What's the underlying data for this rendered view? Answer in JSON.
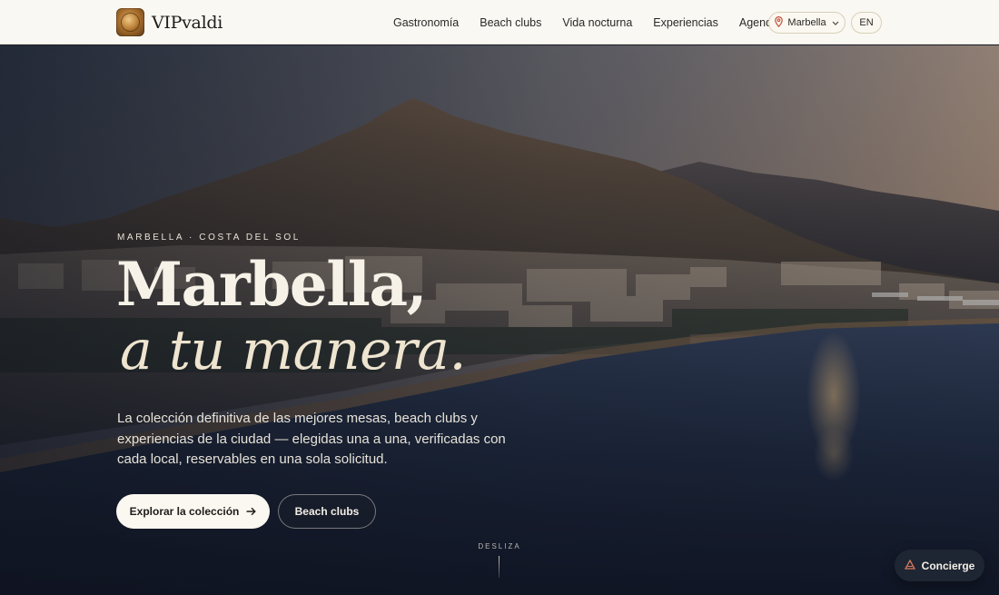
{
  "brand": {
    "name": "VIPvaldi",
    "logo_icon": "coin-logo-icon"
  },
  "nav": {
    "items": [
      {
        "label": "Gastronomía"
      },
      {
        "label": "Beach clubs"
      },
      {
        "label": "Vida nocturna"
      },
      {
        "label": "Experiencias"
      },
      {
        "label": "Agenda"
      }
    ],
    "city": {
      "label": "Marbella",
      "icon": "map-pin-icon",
      "chevron": "chevron-down-icon"
    },
    "language": "EN"
  },
  "hero": {
    "eyebrow": "MARBELLA · COSTA DEL SOL",
    "headline_line1": "Marbella,",
    "headline_line2": "a tu manera.",
    "lede": "La colección definitiva de las mejores mesas, beach clubs y experiencias de la ciudad — elegidas una a una, verificadas con cada local, reservables en una sola solicitud.",
    "primary_cta": {
      "label": "Explorar la colección",
      "icon": "arrow-right-icon"
    },
    "secondary_cta": {
      "label": "Beach clubs"
    },
    "scroll_hint": "DESLIZA"
  },
  "concierge": {
    "label": "Concierge",
    "icon": "triangle-icon"
  },
  "colors": {
    "header_bg": "#faf8f3",
    "cream": "#fbf8f1",
    "accent_pin": "#c4503a",
    "concierge_bg": "#1e2533"
  }
}
